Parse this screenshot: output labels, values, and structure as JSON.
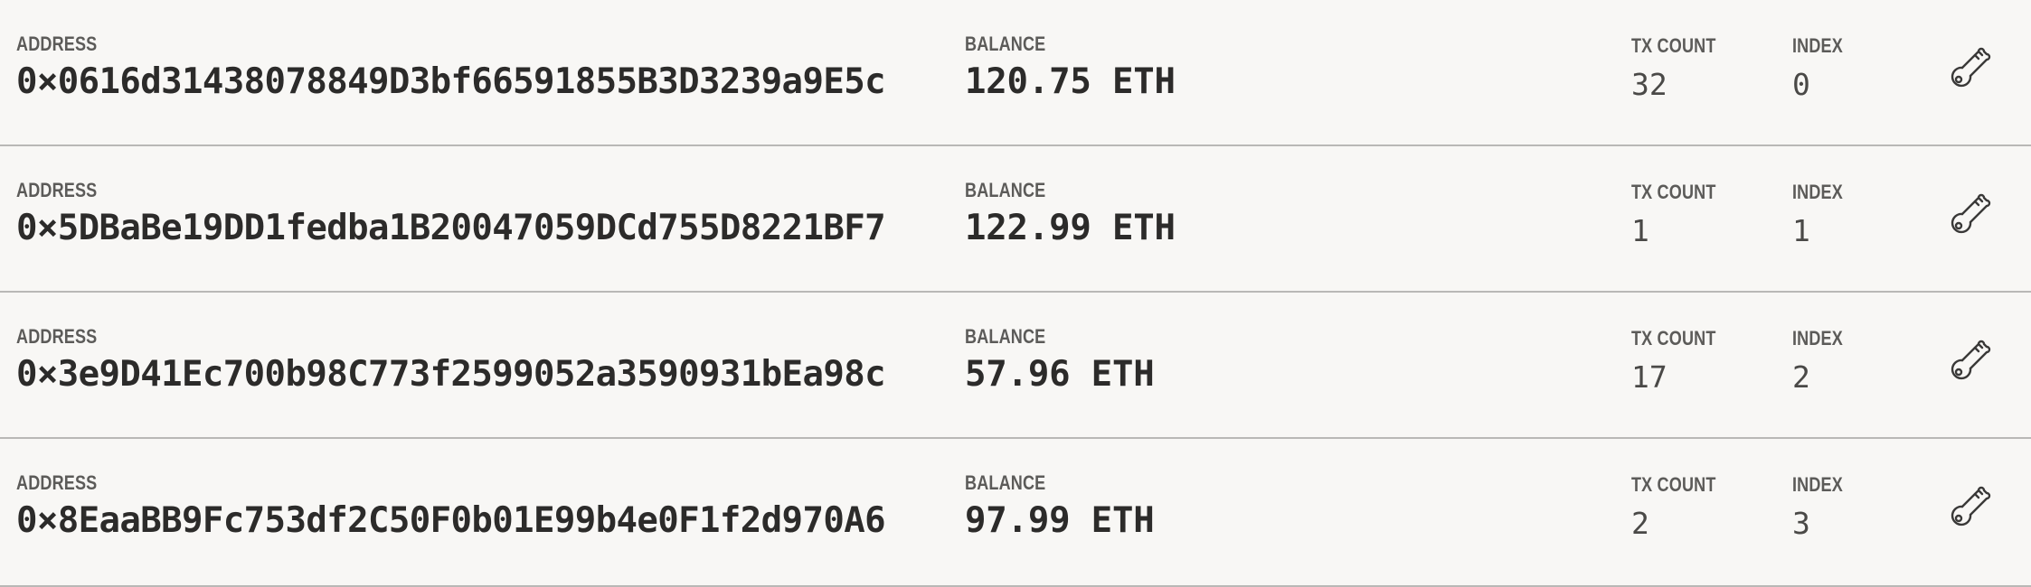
{
  "labels": {
    "address": "ADDRESS",
    "balance": "BALANCE",
    "tx_count": "TX COUNT",
    "index": "INDEX"
  },
  "accounts": [
    {
      "address": "0×0616d31438078849D3bf66591855B3D3239a9E5c",
      "balance": "120.75 ETH",
      "tx_count": "32",
      "index": "0"
    },
    {
      "address": "0×5DBaBe19DD1fedba1B20047059DCd755D8221BF7",
      "balance": "122.99 ETH",
      "tx_count": "1",
      "index": "1"
    },
    {
      "address": "0×3e9D41Ec700b98C773f2599052a3590931bEa98c",
      "balance": "57.96 ETH",
      "tx_count": "17",
      "index": "2"
    },
    {
      "address": "0×8EaaBB9Fc753df2C50F0b01E99b4e0F1f2d970A6",
      "balance": "97.99 ETH",
      "tx_count": "2",
      "index": "3"
    }
  ],
  "icons": {
    "row_action": "key-icon"
  },
  "colors": {
    "background": "#f8f7f5",
    "divider": "#b9b8b6",
    "label": "#5c5b59",
    "value": "#2c2b2a"
  }
}
